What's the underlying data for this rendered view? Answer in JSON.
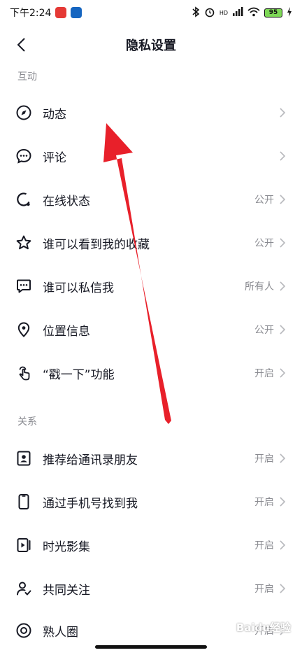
{
  "status_bar": {
    "time": "下午2:24",
    "network": "HD",
    "battery": "95"
  },
  "header": {
    "title": "隐私设置"
  },
  "sections": {
    "interaction": {
      "header": "互动",
      "items": [
        {
          "label": "动态",
          "value": ""
        },
        {
          "label": "评论",
          "value": ""
        },
        {
          "label": "在线状态",
          "value": "公开"
        },
        {
          "label": "谁可以看到我的收藏",
          "value": "公开"
        },
        {
          "label": "谁可以私信我",
          "value": "所有人"
        },
        {
          "label": "位置信息",
          "value": "公开"
        },
        {
          "label": "“戳一下”功能",
          "value": "开启"
        }
      ]
    },
    "relation": {
      "header": "关系",
      "items": [
        {
          "label": "推荐给通讯录朋友",
          "value": "开启"
        },
        {
          "label": "通过手机号找到我",
          "value": "开启"
        },
        {
          "label": "时光影集",
          "value": "开启"
        },
        {
          "label": "共同关注",
          "value": "开启"
        },
        {
          "label": "熟人圈",
          "value": "开启"
        }
      ]
    }
  },
  "icons": {
    "dynamic": "compass-icon",
    "comment": "chat-bubble-icon",
    "online": "online-status-icon",
    "favorites": "star-icon",
    "message": "message-icon",
    "location": "location-pin-icon",
    "poke": "tap-hand-icon",
    "contacts": "contact-card-icon",
    "phone": "phone-icon",
    "album": "play-album-icon",
    "mutual": "user-check-icon",
    "circle": "circle-ring-icon"
  },
  "watermark": "Baidu经验",
  "colors": {
    "annotation_arrow": "#e8202a",
    "muted_text": "#8a8b91"
  }
}
